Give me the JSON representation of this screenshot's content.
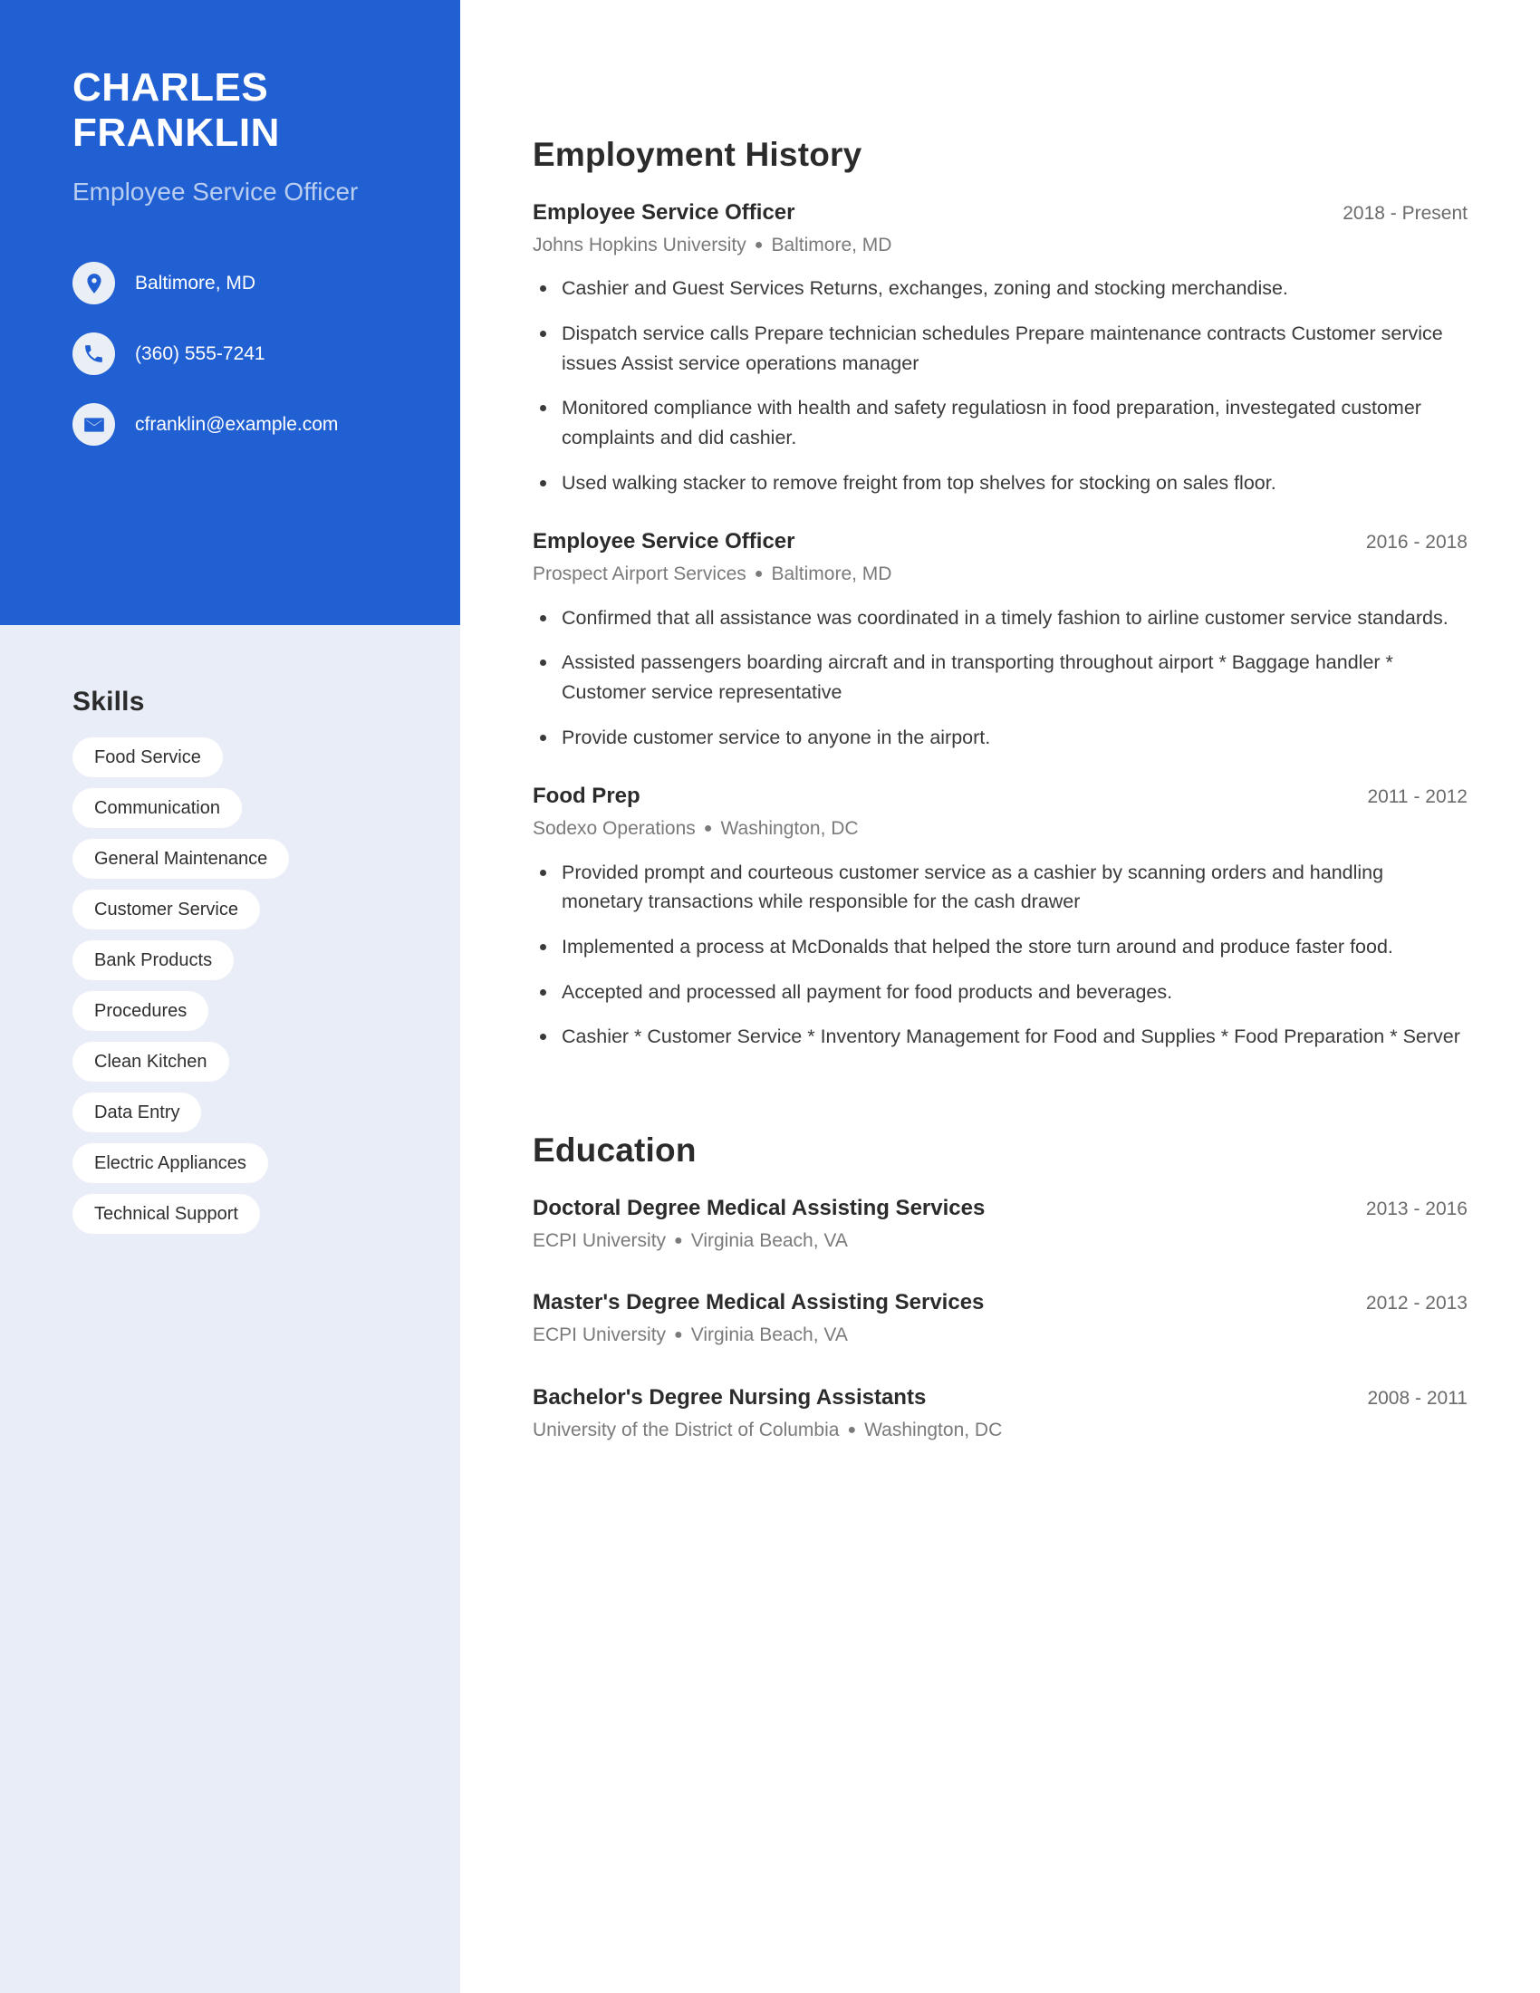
{
  "theme": {
    "accent": "#2160d3",
    "sidebar_bg": "#e8edf7",
    "pill_bg": "#ffffff",
    "subtitle_color": "#b9cdf0",
    "body_text": "#3a3a3a",
    "meta_text": "#7a7a7a"
  },
  "header": {
    "first_name": "CHARLES",
    "last_name": "FRANKLIN",
    "job_title": "Employee Service Officer"
  },
  "contact": {
    "items": [
      {
        "icon": "location-pin-icon",
        "value": "Baltimore, MD"
      },
      {
        "icon": "phone-icon",
        "value": "(360) 555-7241"
      },
      {
        "icon": "envelope-icon",
        "value": "cfranklin@example.com"
      }
    ]
  },
  "skills": {
    "title": "Skills",
    "items": [
      "Food Service",
      "Communication",
      "General Maintenance",
      "Customer Service",
      "Bank Products",
      "Procedures",
      "Clean Kitchen",
      "Data Entry",
      "Electric Appliances",
      "Technical Support"
    ]
  },
  "employment": {
    "title": "Employment History",
    "entries": [
      {
        "role": "Employee Service Officer",
        "date": "2018 - Present",
        "company": "Johns Hopkins University",
        "location": "Baltimore, MD",
        "bullets": [
          "Cashier and Guest Services Returns, exchanges, zoning and stocking merchandise.",
          "Dispatch service calls Prepare technician schedules Prepare maintenance contracts Customer service issues Assist service operations manager",
          "Monitored compliance with health and safety regulatiosn in food preparation, investegated customer complaints and did cashier.",
          "Used walking stacker to remove freight from top shelves for stocking on sales floor."
        ]
      },
      {
        "role": "Employee Service Officer",
        "date": "2016 - 2018",
        "company": "Prospect Airport Services",
        "location": "Baltimore, MD",
        "bullets": [
          "Confirmed that all assistance was coordinated in a timely fashion to airline customer service standards.",
          "Assisted passengers boarding aircraft and in transporting throughout airport * Baggage handler * Customer service representative",
          "Provide customer service to anyone in the airport."
        ]
      },
      {
        "role": "Food Prep",
        "date": "2011 - 2012",
        "company": "Sodexo Operations",
        "location": "Washington, DC",
        "bullets": [
          "Provided prompt and courteous customer service as a cashier by scanning orders and handling monetary transactions while responsible for the cash drawer",
          "Implemented a process at McDonalds that helped the store turn around and produce faster food.",
          "Accepted and processed all payment for food products and beverages.",
          "Cashier * Customer Service * Inventory Management for Food and Supplies * Food Preparation * Server"
        ]
      }
    ]
  },
  "education": {
    "title": "Education",
    "entries": [
      {
        "degree": "Doctoral Degree Medical Assisting Services",
        "date": "2013 - 2016",
        "school": "ECPI University",
        "location": "Virginia Beach, VA"
      },
      {
        "degree": "Master's Degree Medical Assisting Services",
        "date": "2012 - 2013",
        "school": "ECPI University",
        "location": "Virginia Beach, VA"
      },
      {
        "degree": "Bachelor's Degree Nursing Assistants",
        "date": "2008 - 2011",
        "school": "University of the District of Columbia",
        "location": "Washington, DC"
      }
    ]
  }
}
